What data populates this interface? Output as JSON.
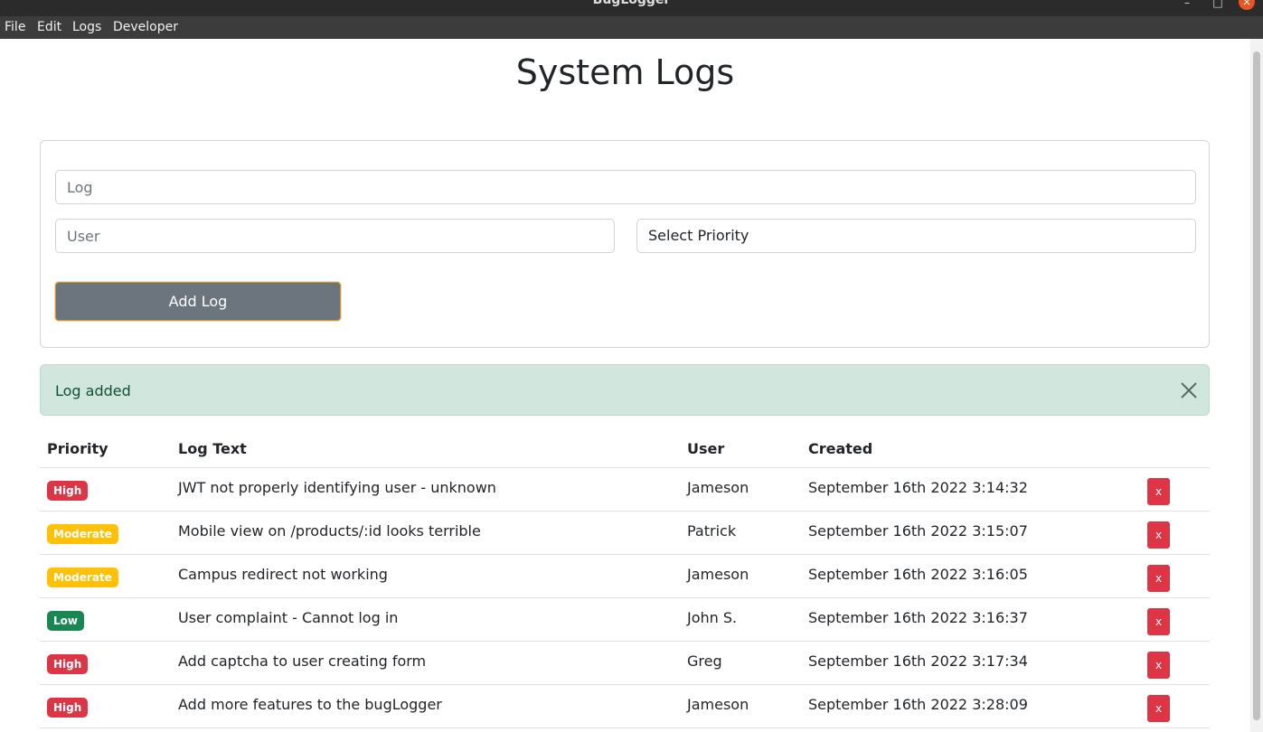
{
  "window": {
    "title": "BugLogger"
  },
  "menu": [
    "File",
    "Edit",
    "Logs",
    "Developer"
  ],
  "page": {
    "title": "System Logs"
  },
  "form": {
    "log_placeholder": "Log",
    "user_placeholder": "User",
    "priority_select": "Select Priority",
    "add_button": "Add Log"
  },
  "alert": {
    "message": "Log added"
  },
  "table": {
    "headers": [
      "Priority",
      "Log Text",
      "User",
      "Created"
    ],
    "delete_label": "x",
    "rows": [
      {
        "priority": "High",
        "text": "JWT not properly identifying user - unknown",
        "user": "Jameson",
        "created": "September 16th 2022 3:14:32"
      },
      {
        "priority": "Moderate",
        "text": "Mobile view on /products/:id looks terrible",
        "user": "Patrick",
        "created": "September 16th 2022 3:15:07"
      },
      {
        "priority": "Moderate",
        "text": "Campus redirect not working",
        "user": "Jameson",
        "created": "September 16th 2022 3:16:05"
      },
      {
        "priority": "Low",
        "text": "User complaint - Cannot log in",
        "user": "John S.",
        "created": "September 16th 2022 3:16:37"
      },
      {
        "priority": "High",
        "text": "Add captcha to user creating form",
        "user": "Greg",
        "created": "September 16th 2022 3:17:34"
      },
      {
        "priority": "High",
        "text": "Add more features to the bugLogger",
        "user": "Jameson",
        "created": "September 16th 2022 3:28:09"
      }
    ]
  },
  "colors": {
    "high": "#dc3545",
    "moderate": "#ffc107",
    "low": "#198754",
    "alert_bg": "#d1e7dd",
    "button": "#6c757d"
  }
}
